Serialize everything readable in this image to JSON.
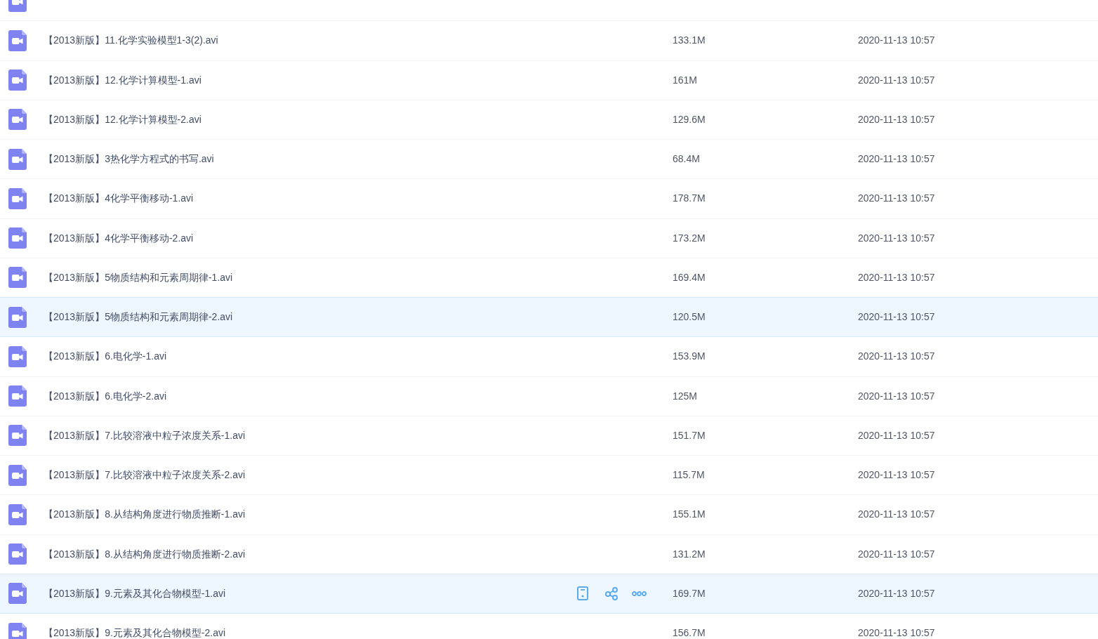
{
  "file_list": {
    "rows": [
      {
        "selected": false,
        "hovered": false
      },
      {
        "name": "【2013新版】11.化学实验模型1-3(2).avi",
        "size": "133.1M",
        "modified": "2020-11-13 10:57",
        "selected": false,
        "hovered": false
      },
      {
        "name": "【2013新版】12.化学计算模型-1.avi",
        "size": "161M",
        "modified": "2020-11-13 10:57",
        "selected": false,
        "hovered": false
      },
      {
        "name": "【2013新版】12.化学计算模型-2.avi",
        "size": "129.6M",
        "modified": "2020-11-13 10:57",
        "selected": false,
        "hovered": false
      },
      {
        "name": "【2013新版】3热化学方程式的书写.avi",
        "size": "68.4M",
        "modified": "2020-11-13 10:57",
        "selected": false,
        "hovered": false
      },
      {
        "name": "【2013新版】4化学平衡移动-1.avi",
        "size": "178.7M",
        "modified": "2020-11-13 10:57",
        "selected": false,
        "hovered": false
      },
      {
        "name": "【2013新版】4化学平衡移动-2.avi",
        "size": "173.2M",
        "modified": "2020-11-13 10:57",
        "selected": false,
        "hovered": false
      },
      {
        "name": "【2013新版】5物质结构和元素周期律-1.avi",
        "size": "169.4M",
        "modified": "2020-11-13 10:57",
        "selected": false,
        "hovered": false
      },
      {
        "name": "【2013新版】5物质结构和元素周期律-2.avi",
        "size": "120.5M",
        "modified": "2020-11-13 10:57",
        "selected": true,
        "hovered": false
      },
      {
        "name": "【2013新版】6.电化学-1.avi",
        "size": "153.9M",
        "modified": "2020-11-13 10:57",
        "selected": false,
        "hovered": false
      },
      {
        "name": "【2013新版】6.电化学-2.avi",
        "size": "125M",
        "modified": "2020-11-13 10:57",
        "selected": false,
        "hovered": false
      },
      {
        "name": "【2013新版】7.比较溶液中粒子浓度关系-1.avi",
        "size": "151.7M",
        "modified": "2020-11-13 10:57",
        "selected": false,
        "hovered": false
      },
      {
        "name": "【2013新版】7.比较溶液中粒子浓度关系-2.avi",
        "size": "115.7M",
        "modified": "2020-11-13 10:57",
        "selected": false,
        "hovered": false
      },
      {
        "name": "【2013新版】8.从结构角度进行物质推断-1.avi",
        "size": "155.1M",
        "modified": "2020-11-13 10:57",
        "selected": false,
        "hovered": false
      },
      {
        "name": "【2013新版】8.从结构角度进行物质推断-2.avi",
        "size": "131.2M",
        "modified": "2020-11-13 10:57",
        "selected": false,
        "hovered": false
      },
      {
        "name": "【2013新版】9.元素及其化合物模型-1.avi",
        "size": "169.7M",
        "modified": "2020-11-13 10:57",
        "selected": true,
        "hovered": true
      },
      {
        "name": "【2013新版】9.元素及其化合物模型-2.avi",
        "size": "156.7M",
        "modified": "2020-11-13 10:57",
        "selected": false,
        "hovered": false
      }
    ]
  }
}
